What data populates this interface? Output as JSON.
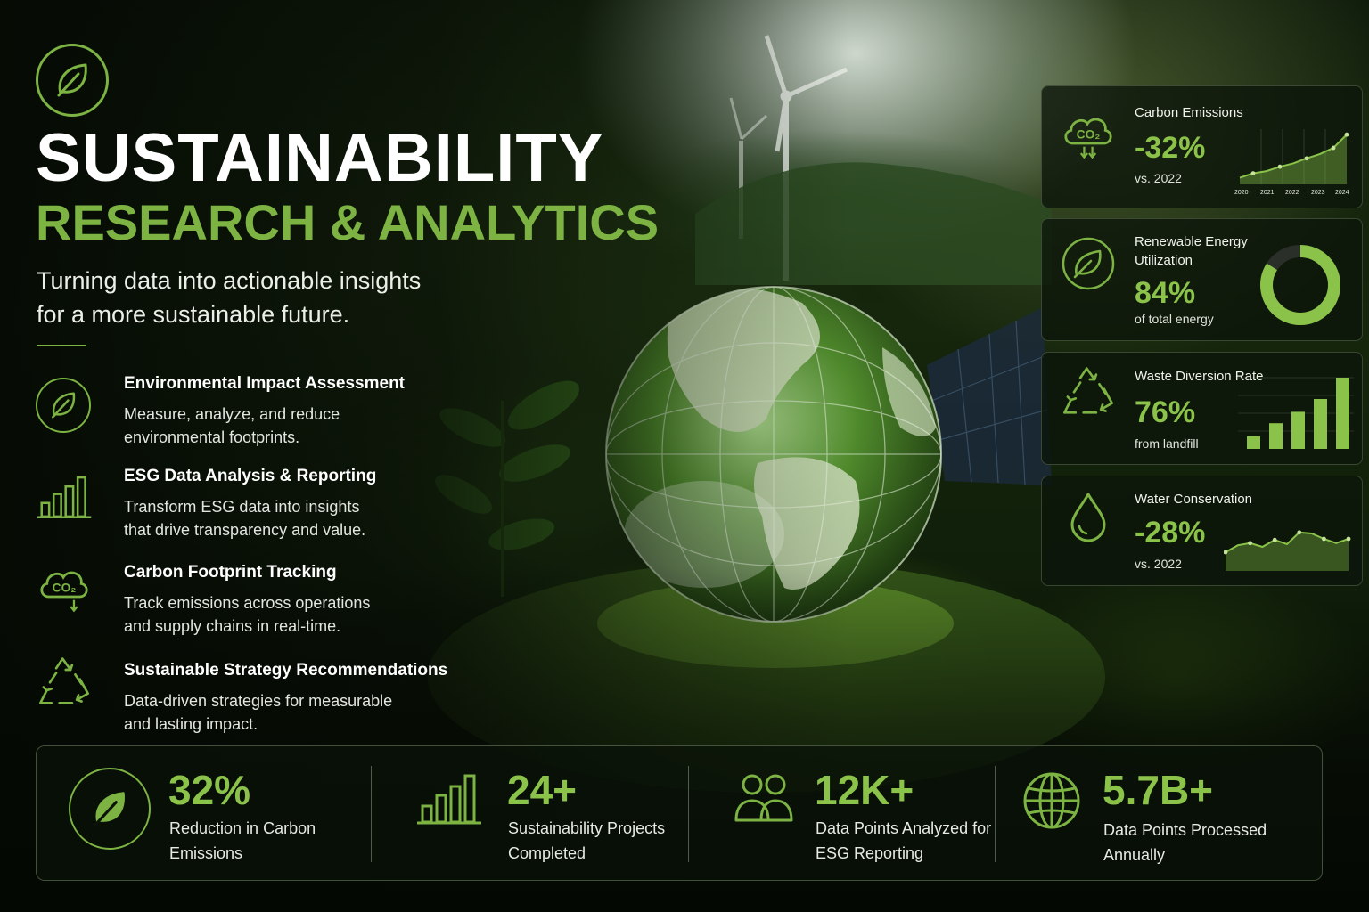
{
  "header": {
    "title": "SUSTAINABILITY",
    "subtitle": "RESEARCH & ANALYTICS",
    "tagline_line1": "Turning data into actionable insights",
    "tagline_line2": "for a more sustainable future."
  },
  "services": [
    {
      "title": "Environmental Impact Assessment",
      "desc_line1": "Measure, analyze, and reduce",
      "desc_line2": "environmental footprints.",
      "icon": "leaf-icon"
    },
    {
      "title": "ESG Data Analysis & Reporting",
      "desc_line1": "Transform ESG data into insights",
      "desc_line2": "that drive transparency and value.",
      "icon": "bar-chart-icon"
    },
    {
      "title": "Carbon Footprint Tracking",
      "desc_line1": "Track emissions across operations",
      "desc_line2": "and supply chains in real-time.",
      "icon": "co2-cloud-icon",
      "icon_text": "CO2"
    },
    {
      "title": "Sustainable Strategy Recommendations",
      "desc_line1": "Data-driven strategies for measurable",
      "desc_line2": "and lasting impact.",
      "icon": "recycle-icon"
    }
  ],
  "metrics": {
    "carbon": {
      "label": "Carbon Emissions",
      "value": "-32%",
      "note": "vs. 2022",
      "icon": "co2-cloud-icon",
      "icon_text": "CO2",
      "years": [
        "2020",
        "2021",
        "2022",
        "2023",
        "2024"
      ],
      "trend": [
        0.12,
        0.2,
        0.24,
        0.32,
        0.38,
        0.47,
        0.55,
        0.66,
        0.9
      ]
    },
    "renewable": {
      "label_line1": "Renewable Energy",
      "label_line2": "Utilization",
      "value": "84%",
      "note": "of total energy",
      "icon": "leaf-icon",
      "fraction": 0.84
    },
    "waste": {
      "label": "Waste Diversion Rate",
      "value": "76%",
      "note": "from landfill",
      "icon": "recycle-icon",
      "bars": [
        0.18,
        0.36,
        0.52,
        0.7,
        1.0
      ]
    },
    "water": {
      "label": "Water Conservation",
      "value": "-28%",
      "note": "vs. 2022",
      "icon": "water-drop-icon",
      "trend": [
        0.35,
        0.48,
        0.52,
        0.45,
        0.58,
        0.5,
        0.72,
        0.7,
        0.6,
        0.52,
        0.6
      ]
    }
  },
  "stats": [
    {
      "value": "32%",
      "label_line1": "Reduction in Carbon",
      "label_line2": "Emissions",
      "icon": "leaf-icon"
    },
    {
      "value": "24+",
      "label_line1": "Sustainability Projects",
      "label_line2": "Completed",
      "icon": "bar-chart-icon"
    },
    {
      "value": "12K+",
      "label_line1": "Data Points Analyzed for",
      "label_line2": "ESG Reporting",
      "icon": "users-icon"
    },
    {
      "value": "5.7B+",
      "label_line1": "Data Points Processed",
      "label_line2": "Annually",
      "icon": "globe-icon"
    }
  ],
  "colors": {
    "accent": "#7cb342",
    "accent_bright": "#8bc34a",
    "text": "#ffffff",
    "card_bg": "#0c140a"
  }
}
